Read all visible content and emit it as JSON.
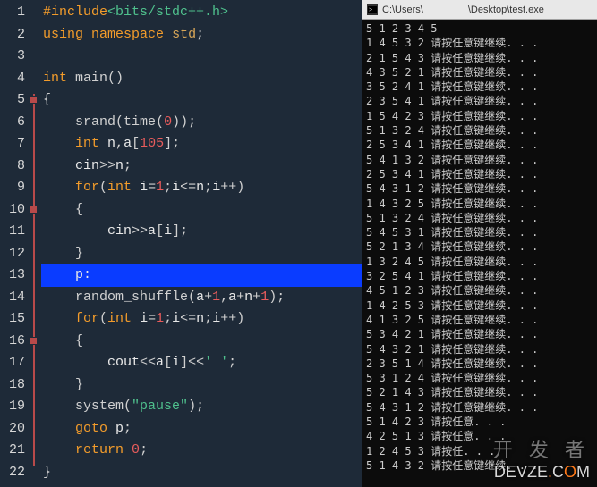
{
  "editor": {
    "lines": [
      {
        "n": 1,
        "html": "<span class='pp'>#include</span><span class='inc'>&lt;bits/stdc++.h&gt;</span>"
      },
      {
        "n": 2,
        "html": "<span class='kw'>using</span> <span class='kw'>namespace</span> <span class='ident'>std</span><span class='punct'>;</span>"
      },
      {
        "n": 3,
        "html": ""
      },
      {
        "n": 4,
        "html": "<span class='type'>int</span> <span class='func'>main</span><span class='punct'>()</span>"
      },
      {
        "n": 5,
        "html": "<span class='punct'>{</span>"
      },
      {
        "n": 6,
        "html": "    <span class='func'>srand</span><span class='punct'>(</span><span class='func'>time</span><span class='punct'>(</span><span class='num'>0</span><span class='punct'>));</span>"
      },
      {
        "n": 7,
        "html": "    <span class='type'>int</span> n<span class='punct'>,</span>a<span class='punct'>[</span><span class='num'>105</span><span class='punct'>];</span>"
      },
      {
        "n": 8,
        "html": "    cin<span class='op'>&gt;&gt;</span>n<span class='punct'>;</span>"
      },
      {
        "n": 9,
        "html": "    <span class='kw'>for</span><span class='punct'>(</span><span class='type'>int</span> i<span class='op'>=</span><span class='num'>1</span><span class='punct'>;</span>i<span class='op'>&lt;=</span>n<span class='punct'>;</span>i<span class='op'>++</span><span class='punct'>)</span>"
      },
      {
        "n": 10,
        "html": "    <span class='punct'>{</span>"
      },
      {
        "n": 11,
        "html": "        cin<span class='op'>&gt;&gt;</span>a<span class='punct'>[</span>i<span class='punct'>];</span>"
      },
      {
        "n": 12,
        "html": "    <span class='punct'>}</span>"
      },
      {
        "n": 13,
        "html": "    <span class='lbl'>p:</span>",
        "hl": true
      },
      {
        "n": 14,
        "html": "    <span class='func'>random_shuffle</span><span class='punct'>(</span>a<span class='op'>+</span><span class='num'>1</span><span class='punct'>,</span>a<span class='op'>+</span>n<span class='op'>+</span><span class='num'>1</span><span class='punct'>);</span>"
      },
      {
        "n": 15,
        "html": "    <span class='kw'>for</span><span class='punct'>(</span><span class='type'>int</span> i<span class='op'>=</span><span class='num'>1</span><span class='punct'>;</span>i<span class='op'>&lt;=</span>n<span class='punct'>;</span>i<span class='op'>++</span><span class='punct'>)</span>"
      },
      {
        "n": 16,
        "html": "    <span class='punct'>{</span>"
      },
      {
        "n": 17,
        "html": "        cout<span class='op'>&lt;&lt;</span>a<span class='punct'>[</span>i<span class='punct'>]</span><span class='op'>&lt;&lt;</span><span class='str'>' '</span><span class='punct'>;</span>"
      },
      {
        "n": 18,
        "html": "    <span class='punct'>}</span>"
      },
      {
        "n": 19,
        "html": "    <span class='func'>system</span><span class='punct'>(</span><span class='str'>\"pause\"</span><span class='punct'>);</span>"
      },
      {
        "n": 20,
        "html": "    <span class='kw'>goto</span> p<span class='punct'>;</span>"
      },
      {
        "n": 21,
        "html": "    <span class='kw'>return</span> <span class='num'>0</span><span class='punct'>;</span>"
      },
      {
        "n": 22,
        "html": "<span class='punct'>}</span>"
      }
    ],
    "fold_markers": [
      5,
      10,
      16
    ]
  },
  "console": {
    "title_prefix": "C:\\Users\\",
    "title_suffix": "\\Desktop\\test.exe",
    "rows": [
      "5 1 2 3 4 5",
      "1 4 5 3 2 请按任意键继续. . .",
      "2 1 5 4 3 请按任意键继续. . .",
      "4 3 5 2 1 请按任意键继续. . .",
      "3 5 2 4 1 请按任意键继续. . .",
      "2 3 5 4 1 请按任意键继续. . .",
      "1 5 4 2 3 请按任意键继续. . .",
      "5 1 3 2 4 请按任意键继续. . .",
      "2 5 3 4 1 请按任意键继续. . .",
      "5 4 1 3 2 请按任意键继续. . .",
      "2 5 3 4 1 请按任意键继续. . .",
      "5 4 3 1 2 请按任意键继续. . .",
      "1 4 3 2 5 请按任意键继续. . .",
      "5 1 3 2 4 请按任意键继续. . .",
      "5 4 5 3 1 请按任意键继续. . .",
      "5 2 1 3 4 请按任意键继续. . .",
      "1 3 2 4 5 请按任意键继续. . .",
      "3 2 5 4 1 请按任意键继续. . .",
      "4 5 1 2 3 请按任意键继续. . .",
      "1 4 2 5 3 请按任意键继续. . .",
      "4 1 3 2 5 请按任意键继续. . .",
      "5 3 4 2 1 请按任意键继续. . .",
      "5 4 3 2 1 请按任意键继续. . .",
      "2 3 5 1 4 请按任意键继续. . .",
      "5 3 1 2 4 请按任意键继续. . .",
      "5 2 1 4 3 请按任意键继续. . .",
      "5 4 3 1 2 请按任意键继续. . .",
      "5 1 4 2 3 请按任意. . .",
      "4 2 5 1 3 请按任意. . .",
      "1 2 4 5 3 请按任. . .",
      "5 1 4 3 2 请按任意键继续. . ."
    ]
  },
  "watermark": {
    "cn": "开 发 者",
    "en_parts": [
      "D",
      "E",
      "V",
      "Z",
      "E",
      ".",
      "C",
      "O",
      "M"
    ]
  }
}
